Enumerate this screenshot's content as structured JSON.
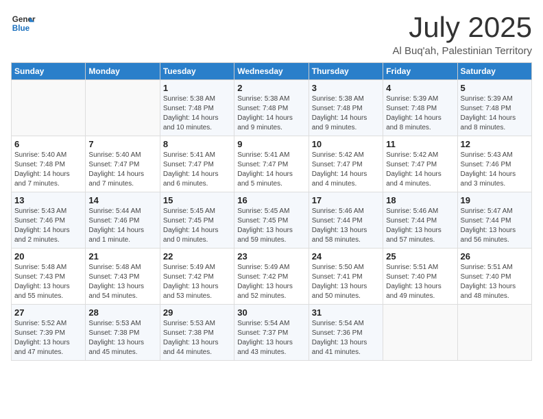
{
  "header": {
    "logo_line1": "General",
    "logo_line2": "Blue",
    "title": "July 2025",
    "location": "Al Buq'ah, Palestinian Territory"
  },
  "days_of_week": [
    "Sunday",
    "Monday",
    "Tuesday",
    "Wednesday",
    "Thursday",
    "Friday",
    "Saturday"
  ],
  "weeks": [
    [
      {
        "day": "",
        "info": ""
      },
      {
        "day": "",
        "info": ""
      },
      {
        "day": "1",
        "info": "Sunrise: 5:38 AM\nSunset: 7:48 PM\nDaylight: 14 hours and 10 minutes."
      },
      {
        "day": "2",
        "info": "Sunrise: 5:38 AM\nSunset: 7:48 PM\nDaylight: 14 hours and 9 minutes."
      },
      {
        "day": "3",
        "info": "Sunrise: 5:38 AM\nSunset: 7:48 PM\nDaylight: 14 hours and 9 minutes."
      },
      {
        "day": "4",
        "info": "Sunrise: 5:39 AM\nSunset: 7:48 PM\nDaylight: 14 hours and 8 minutes."
      },
      {
        "day": "5",
        "info": "Sunrise: 5:39 AM\nSunset: 7:48 PM\nDaylight: 14 hours and 8 minutes."
      }
    ],
    [
      {
        "day": "6",
        "info": "Sunrise: 5:40 AM\nSunset: 7:48 PM\nDaylight: 14 hours and 7 minutes."
      },
      {
        "day": "7",
        "info": "Sunrise: 5:40 AM\nSunset: 7:47 PM\nDaylight: 14 hours and 7 minutes."
      },
      {
        "day": "8",
        "info": "Sunrise: 5:41 AM\nSunset: 7:47 PM\nDaylight: 14 hours and 6 minutes."
      },
      {
        "day": "9",
        "info": "Sunrise: 5:41 AM\nSunset: 7:47 PM\nDaylight: 14 hours and 5 minutes."
      },
      {
        "day": "10",
        "info": "Sunrise: 5:42 AM\nSunset: 7:47 PM\nDaylight: 14 hours and 4 minutes."
      },
      {
        "day": "11",
        "info": "Sunrise: 5:42 AM\nSunset: 7:47 PM\nDaylight: 14 hours and 4 minutes."
      },
      {
        "day": "12",
        "info": "Sunrise: 5:43 AM\nSunset: 7:46 PM\nDaylight: 14 hours and 3 minutes."
      }
    ],
    [
      {
        "day": "13",
        "info": "Sunrise: 5:43 AM\nSunset: 7:46 PM\nDaylight: 14 hours and 2 minutes."
      },
      {
        "day": "14",
        "info": "Sunrise: 5:44 AM\nSunset: 7:46 PM\nDaylight: 14 hours and 1 minute."
      },
      {
        "day": "15",
        "info": "Sunrise: 5:45 AM\nSunset: 7:45 PM\nDaylight: 14 hours and 0 minutes."
      },
      {
        "day": "16",
        "info": "Sunrise: 5:45 AM\nSunset: 7:45 PM\nDaylight: 13 hours and 59 minutes."
      },
      {
        "day": "17",
        "info": "Sunrise: 5:46 AM\nSunset: 7:44 PM\nDaylight: 13 hours and 58 minutes."
      },
      {
        "day": "18",
        "info": "Sunrise: 5:46 AM\nSunset: 7:44 PM\nDaylight: 13 hours and 57 minutes."
      },
      {
        "day": "19",
        "info": "Sunrise: 5:47 AM\nSunset: 7:44 PM\nDaylight: 13 hours and 56 minutes."
      }
    ],
    [
      {
        "day": "20",
        "info": "Sunrise: 5:48 AM\nSunset: 7:43 PM\nDaylight: 13 hours and 55 minutes."
      },
      {
        "day": "21",
        "info": "Sunrise: 5:48 AM\nSunset: 7:43 PM\nDaylight: 13 hours and 54 minutes."
      },
      {
        "day": "22",
        "info": "Sunrise: 5:49 AM\nSunset: 7:42 PM\nDaylight: 13 hours and 53 minutes."
      },
      {
        "day": "23",
        "info": "Sunrise: 5:49 AM\nSunset: 7:42 PM\nDaylight: 13 hours and 52 minutes."
      },
      {
        "day": "24",
        "info": "Sunrise: 5:50 AM\nSunset: 7:41 PM\nDaylight: 13 hours and 50 minutes."
      },
      {
        "day": "25",
        "info": "Sunrise: 5:51 AM\nSunset: 7:40 PM\nDaylight: 13 hours and 49 minutes."
      },
      {
        "day": "26",
        "info": "Sunrise: 5:51 AM\nSunset: 7:40 PM\nDaylight: 13 hours and 48 minutes."
      }
    ],
    [
      {
        "day": "27",
        "info": "Sunrise: 5:52 AM\nSunset: 7:39 PM\nDaylight: 13 hours and 47 minutes."
      },
      {
        "day": "28",
        "info": "Sunrise: 5:53 AM\nSunset: 7:38 PM\nDaylight: 13 hours and 45 minutes."
      },
      {
        "day": "29",
        "info": "Sunrise: 5:53 AM\nSunset: 7:38 PM\nDaylight: 13 hours and 44 minutes."
      },
      {
        "day": "30",
        "info": "Sunrise: 5:54 AM\nSunset: 7:37 PM\nDaylight: 13 hours and 43 minutes."
      },
      {
        "day": "31",
        "info": "Sunrise: 5:54 AM\nSunset: 7:36 PM\nDaylight: 13 hours and 41 minutes."
      },
      {
        "day": "",
        "info": ""
      },
      {
        "day": "",
        "info": ""
      }
    ]
  ]
}
